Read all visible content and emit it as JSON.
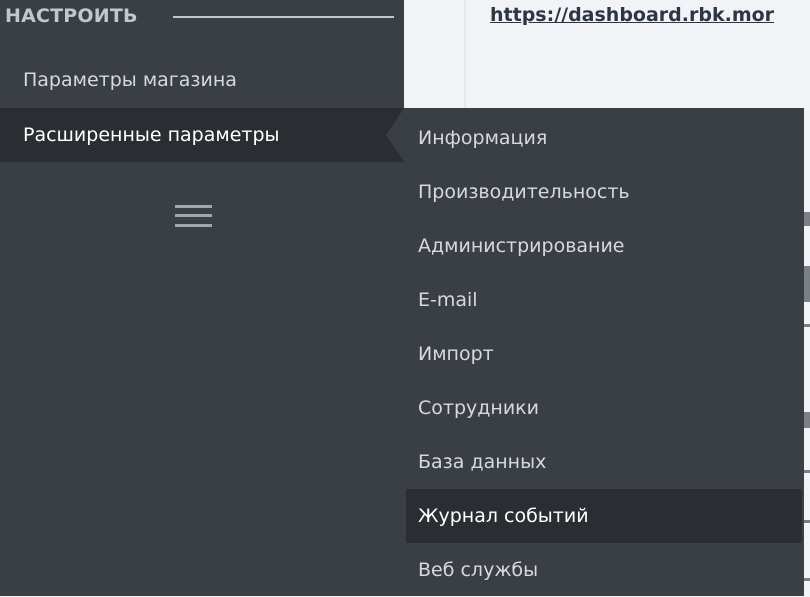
{
  "content": {
    "url_text": "https://dashboard.rbk.mor"
  },
  "sidebar": {
    "section_title": "НАСТРОИТЬ",
    "items": [
      {
        "label": "Параметры магазина"
      },
      {
        "label": "Расширенные параметры",
        "active": true
      }
    ],
    "menu_icon": "hamburger-menu-icon"
  },
  "flyout": {
    "items": [
      {
        "label": "Информация"
      },
      {
        "label": "Производительность"
      },
      {
        "label": "Администрирование"
      },
      {
        "label": "E-mail"
      },
      {
        "label": "Импорт"
      },
      {
        "label": "Сотрудники"
      },
      {
        "label": "База данных"
      },
      {
        "label": "Журнал событий",
        "highlighted": true
      },
      {
        "label": "Веб службы"
      }
    ]
  },
  "colors": {
    "sidebar_bg": "#3a3e45",
    "active_bg": "#2a2d32",
    "content_bg": "#f1f3f7",
    "text_light": "#d6d9dd",
    "section_title": "#c2c7cd"
  }
}
